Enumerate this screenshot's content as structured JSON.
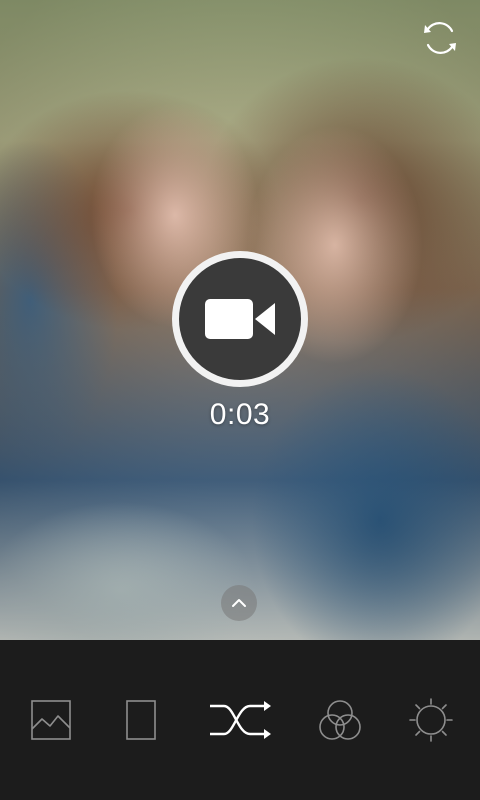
{
  "viewfinder": {
    "timer": "0:03"
  },
  "controls": {
    "switch_camera_icon": "camera-switch-icon",
    "record_icon": "video-camera-icon",
    "expand_icon": "chevron-up-icon"
  },
  "toolbar": {
    "items": [
      {
        "icon": "gallery-icon",
        "active": false
      },
      {
        "icon": "frame-icon",
        "active": false
      },
      {
        "icon": "shuffle-icon",
        "active": true
      },
      {
        "icon": "filters-icon",
        "active": false
      },
      {
        "icon": "settings-icon",
        "active": false
      }
    ]
  },
  "colors": {
    "toolbar_bg": "#1c1c1c",
    "icon_active": "#ffffff",
    "icon_inactive": "#8e8e8e",
    "record_ring": "#f2f2f2",
    "record_fill": "#3a3a3a"
  }
}
